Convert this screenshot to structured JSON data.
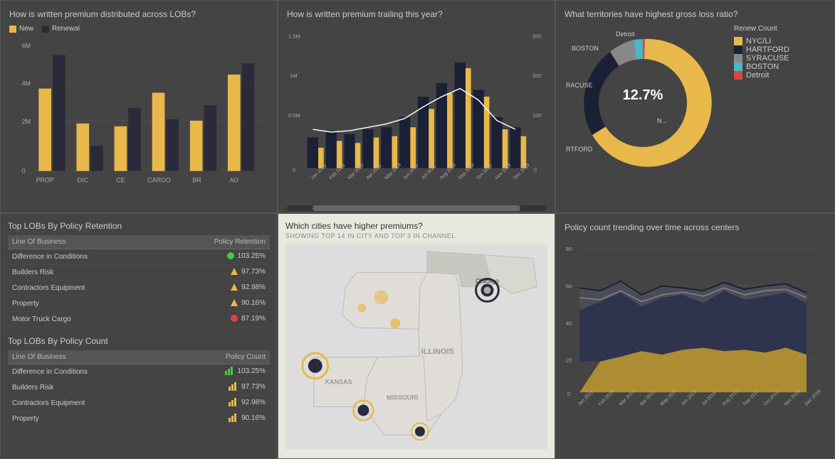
{
  "panels": {
    "p1": {
      "title": "How is written premium distributed across LOBs?",
      "legend": [
        {
          "label": "New",
          "color": "#e8b84b"
        },
        {
          "label": "Renewal",
          "color": "#2a2a3a"
        }
      ],
      "yLabels": [
        "6M",
        "4M",
        "2M",
        "0"
      ],
      "xLabels": [
        "PROP",
        "DIC",
        "CE",
        "CARGO",
        "BR",
        "AO"
      ],
      "bars": [
        {
          "new": 120,
          "renewal": 170
        },
        {
          "new": 60,
          "renewal": 25
        },
        {
          "new": 55,
          "renewal": 75
        },
        {
          "new": 105,
          "renewal": 55
        },
        {
          "new": 60,
          "renewal": 80
        },
        {
          "new": 155,
          "renewal": 185
        }
      ]
    },
    "p2": {
      "title": "How is written premium trailing this year?",
      "yLeft": [
        "1.5M",
        "1M",
        "0.5M",
        "0"
      ],
      "yRight": [
        "300",
        "200",
        "100",
        "0"
      ],
      "xLabels": [
        "Jan 2019",
        "Feb 2019",
        "Mar 2019",
        "Apr 2019",
        "May 2019",
        "Jun 2019",
        "Jul 2019",
        "Aug 2019",
        "Sep 2019",
        "Oct 2019",
        "Nov 2019",
        "Dec 2019"
      ]
    },
    "p3": {
      "title": "What territories have highest gross loss ratio?",
      "legendTitle": "Renew Count",
      "centerValue": "12.7%",
      "labels": [
        "NYC/LI",
        "HARTFORD",
        "SYRACUSE",
        "BOSTON",
        "Detroit"
      ],
      "colors": [
        "#e8b84b",
        "#1a2035",
        "#888",
        "#4ab8c8",
        "#d44"
      ],
      "segments": [
        {
          "label": "NYC/LI",
          "pct": 60,
          "color": "#e8b84b"
        },
        {
          "label": "HARTFORD",
          "pct": 20,
          "color": "#1a2035"
        },
        {
          "label": "SYRACUSE",
          "pct": 10,
          "color": "#888"
        },
        {
          "label": "BOSTON",
          "pct": 6,
          "color": "#4ab8c8"
        },
        {
          "label": "Detroit",
          "pct": 4,
          "color": "#d44"
        }
      ],
      "outerLabels": [
        "Detroit",
        "BOSTON",
        "RACUSE",
        "N...",
        "RTFORD"
      ]
    },
    "p4": {
      "retention_title": "Top LOBs By Policy Retention",
      "retention_table_headers": [
        "Line Of Business",
        "Policy Retention"
      ],
      "retention_rows": [
        {
          "lob": "Difference in Conditions",
          "indicator": "green-circle",
          "value": "103.25%"
        },
        {
          "lob": "Builders Risk",
          "indicator": "yellow-triangle",
          "value": "97.73%"
        },
        {
          "lob": "Contractors Equipment",
          "indicator": "yellow-triangle",
          "value": "92.98%"
        },
        {
          "lob": "Property",
          "indicator": "yellow-triangle",
          "value": "90.16%"
        },
        {
          "lob": "Motor Truck Cargo",
          "indicator": "red-circle",
          "value": "87.19%"
        }
      ],
      "count_title": "Top LOBs By Policy Count",
      "count_table_headers": [
        "Line Of Business",
        "Policy Count"
      ],
      "count_rows": [
        {
          "lob": "Difference in Conditions",
          "indicator": "green-bars",
          "value": "103.25%"
        },
        {
          "lob": "Builders Risk",
          "indicator": "yellow-bars",
          "value": "97.73%"
        },
        {
          "lob": "Contractors Equipment",
          "indicator": "yellow-bars",
          "value": "92.98%"
        },
        {
          "lob": "Property",
          "indicator": "yellow-bars",
          "value": "90.16%"
        }
      ]
    },
    "p5": {
      "title": "Which cities have higher premiums?",
      "subtitle": "SHOWING TOP 14 IN CITY AND TOP 3 IN CHANNEL",
      "labels": [
        "Chicago",
        "ILLINOIS",
        "MISSOURI",
        "KANSAS"
      ]
    },
    "p6": {
      "title": "Policy count trending over time across centers",
      "yLabels": [
        "80",
        "60",
        "40",
        "20",
        "0"
      ],
      "xLabels": [
        "Jan 2019",
        "Feb 2019",
        "Mar 2019",
        "Apr 2019",
        "May 2019",
        "Jun 2019",
        "Jul 2019",
        "Aug 2019",
        "Sep 2019",
        "Oct 2019",
        "Nov 2019",
        "Dec 2019"
      ]
    }
  }
}
